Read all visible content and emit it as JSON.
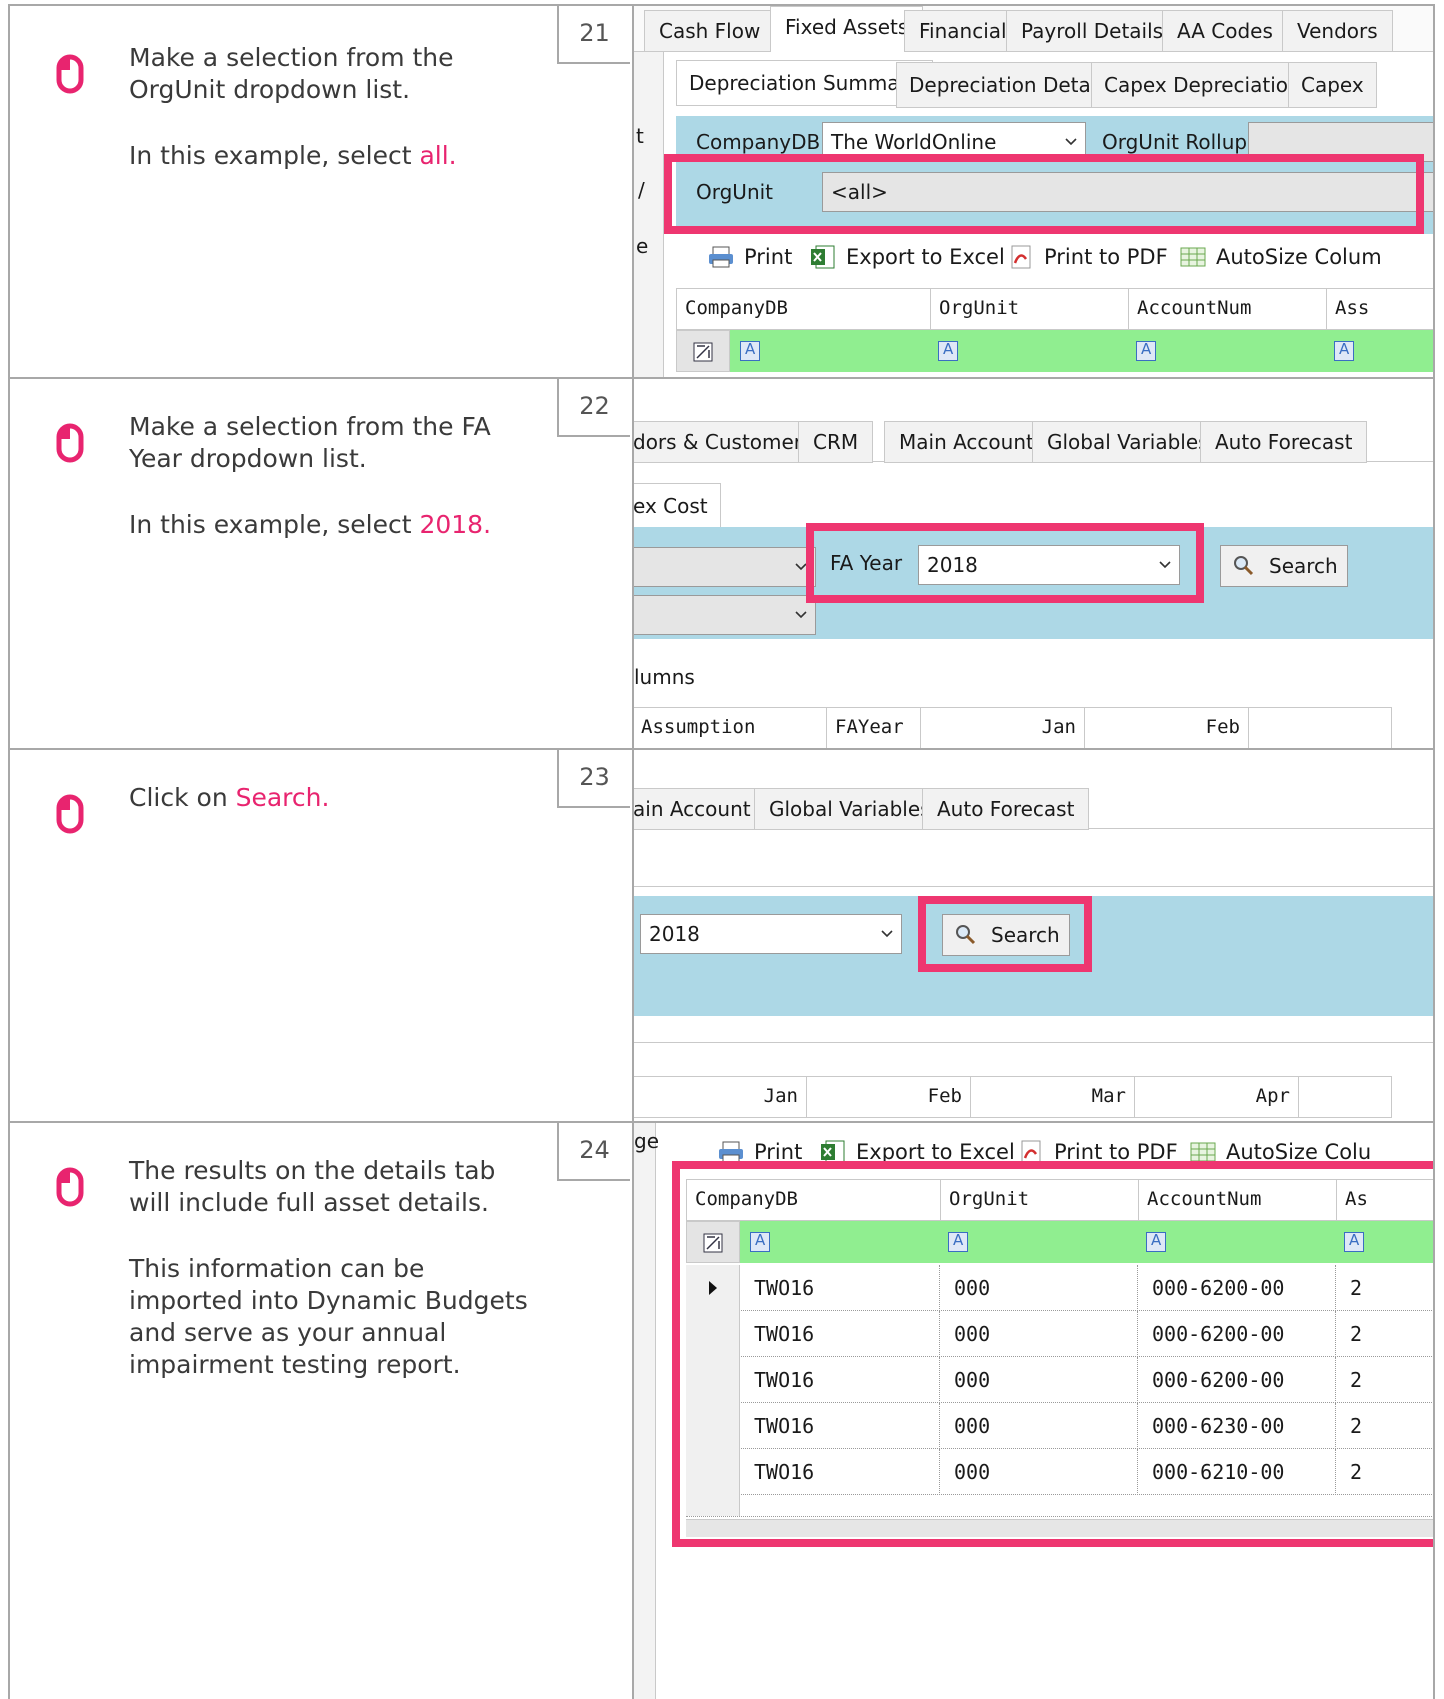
{
  "steps": [
    {
      "number": "21",
      "paragraphs": [
        {
          "before": "Make a selection from the OrgUnit dropdown list.",
          "highlight": ""
        },
        {
          "before": "In this example, select ",
          "highlight": "all."
        }
      ],
      "ui": {
        "tabs": [
          "Cash Flow",
          "Fixed Assets",
          "Financial",
          "Payroll Details",
          "AA Codes",
          "Vendors"
        ],
        "subtabs": [
          "Depreciation Summary",
          "Depreciation Details",
          "Capex Depreciation",
          "Capex"
        ],
        "companydb_label": "CompanyDB",
        "companydb_value": "The WorldOnline",
        "orgunit_rollup_label": "OrgUnit Rollup",
        "orgunit_label": "OrgUnit",
        "orgunit_value": "<all>",
        "side_fragments": [
          "t",
          "t",
          "/",
          "e"
        ],
        "toolbar": [
          "Print",
          "Export to Excel",
          "Print to PDF",
          "AutoSize Colum"
        ],
        "columns": [
          "CompanyDB",
          "OrgUnit",
          "AccountNum",
          "Ass"
        ]
      }
    },
    {
      "number": "22",
      "paragraphs": [
        {
          "before": "Make a selection from the FA Year dropdown list.",
          "highlight": ""
        },
        {
          "before": "In this example, select ",
          "highlight": "2018."
        }
      ],
      "ui": {
        "tabs": [
          "dors & Customers",
          "CRM",
          "Main Account",
          "Global Variables",
          "Auto Forecast"
        ],
        "subtab": "ex Cost",
        "fa_year_label": "FA Year",
        "fa_year_value": "2018",
        "search_label": "Search",
        "columns_fragment": "lumns",
        "columns": [
          "Assumption",
          "FAYear",
          "Jan",
          "Feb"
        ]
      }
    },
    {
      "number": "23",
      "paragraphs": [
        {
          "before": "Click on ",
          "highlight": "Search."
        }
      ],
      "ui": {
        "tabs": [
          "ain Account",
          "Global Variables",
          "Auto Forecast"
        ],
        "year_value": "2018",
        "search_label": "Search",
        "columns": [
          "Jan",
          "Feb",
          "Mar",
          "Apr"
        ]
      }
    },
    {
      "number": "24",
      "paragraphs": [
        {
          "before": "The results on the details tab will include full asset details.",
          "highlight": ""
        },
        {
          "before": "This information can be imported into Dynamic Budgets and serve as your annual impairment testing report.",
          "highlight": ""
        }
      ],
      "ui": {
        "side_fragment": "ge",
        "toolbar": [
          "Print",
          "Export to Excel",
          "Print to PDF",
          "AutoSize Colu"
        ],
        "columns": [
          "CompanyDB",
          "OrgUnit",
          "AccountNum",
          "As"
        ],
        "rows": [
          [
            "TWO16",
            "000",
            "000-6200-00",
            "2"
          ],
          [
            "TWO16",
            "000",
            "000-6200-00",
            "2"
          ],
          [
            "TWO16",
            "000",
            "000-6200-00",
            "2"
          ],
          [
            "TWO16",
            "000",
            "000-6230-00",
            "2"
          ],
          [
            "TWO16",
            "000",
            "000-6210-00",
            "2"
          ]
        ]
      }
    }
  ]
}
